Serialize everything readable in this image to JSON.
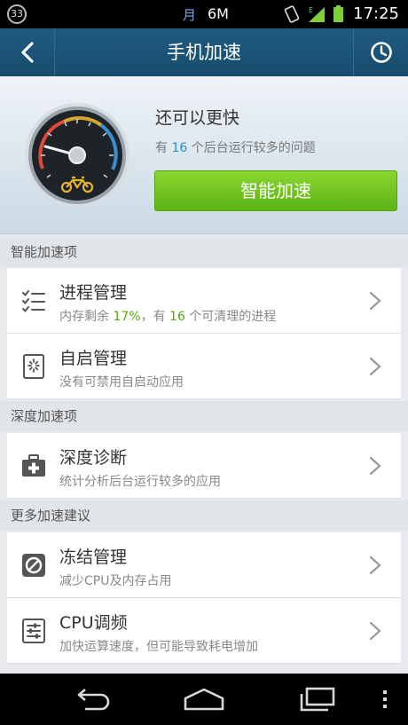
{
  "status_bar": {
    "badge": "33",
    "moon_glyph": "月",
    "traffic": "6M",
    "time": "17:25"
  },
  "title_bar": {
    "title": "手机加速"
  },
  "header": {
    "title": "还可以更快",
    "subtitle_prefix": "有 ",
    "subtitle_count": "16",
    "subtitle_suffix": " 个后台运行较多的问题",
    "boost_button": "智能加速"
  },
  "sections": [
    {
      "label": "智能加速项",
      "items": [
        {
          "icon": "process-list-icon",
          "title": "进程管理",
          "sub_a": "内存剩余 ",
          "sub_b": "17%",
          "sub_c": "，有 ",
          "sub_d": "16",
          "sub_e": " 个可清理的进程"
        },
        {
          "icon": "autostart-icon",
          "title": "自启管理",
          "sub": "没有可禁用自启动应用"
        }
      ]
    },
    {
      "label": "深度加速项",
      "items": [
        {
          "icon": "medical-kit-icon",
          "title": "深度诊断",
          "sub": "统计分析后台运行较多的应用"
        }
      ]
    },
    {
      "label": "更多加速建议",
      "items": [
        {
          "icon": "freeze-icon",
          "title": "冻结管理",
          "sub": "减少CPU及内存占用"
        },
        {
          "icon": "cpu-tuning-icon",
          "title": "CPU调频",
          "sub": "加快运算速度，但可能导致耗电增加"
        }
      ]
    }
  ],
  "colors": {
    "title_bar": "#1f5b80",
    "accent_green": "#6cc21d",
    "number_blue": "#2c8ec7",
    "number_green": "#57a90d"
  }
}
